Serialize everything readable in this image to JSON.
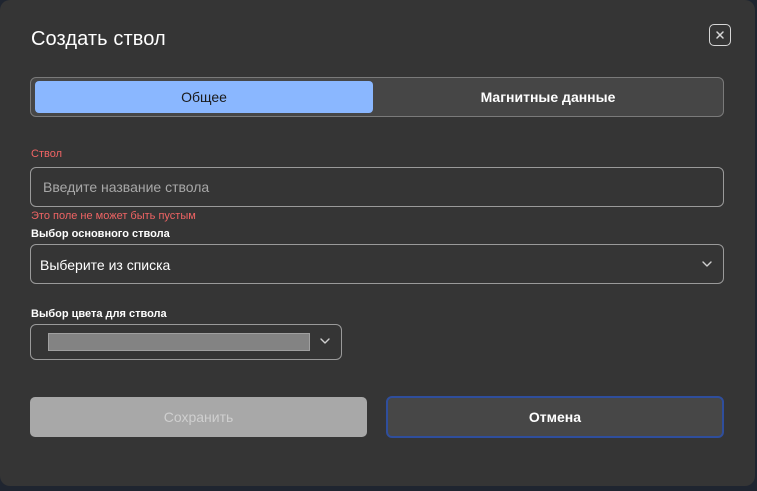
{
  "dialog": {
    "title": "Создать ствол",
    "close_icon": "close-icon"
  },
  "tabs": [
    {
      "label": "Общее",
      "active": true
    },
    {
      "label": "Магнитные данные",
      "active": false
    }
  ],
  "trunk_field": {
    "label": "Ствол",
    "placeholder": "Введите название ствола",
    "value": "",
    "error": "Это поле не может быть пустым"
  },
  "main_trunk": {
    "label": "Выбор основного ствола",
    "selected": "Выберите из списка",
    "icon": "chevron-down-icon"
  },
  "color": {
    "label": "Выбор цвета для ствола",
    "swatch_color": "#838383",
    "icon": "chevron-down-icon"
  },
  "buttons": {
    "save": "Сохранить",
    "cancel": "Отмена"
  },
  "colors": {
    "background": "#353535",
    "accent_tab": "#8ab7ff",
    "error": "#ef6464",
    "focus_border": "#2f4e9c"
  }
}
